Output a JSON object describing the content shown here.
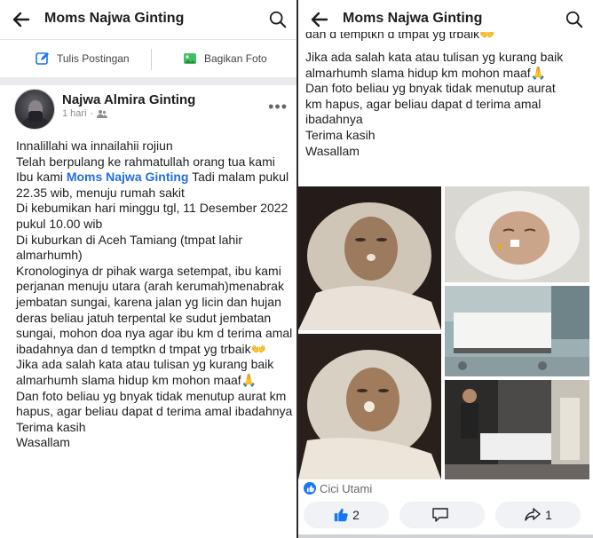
{
  "header": {
    "title": "Moms Najwa Ginting"
  },
  "composer": {
    "write_label": "Tulis Postingan",
    "photo_label": "Bagikan Foto"
  },
  "post": {
    "author": "Najwa Almira Ginting",
    "time": "1 hari",
    "separator": "·",
    "lines_left": {
      "l1": "Innalillahi wa innailahii rojiun",
      "l2": "Telah berpulang ke rahmatullah orang tua kami",
      "l3_pre": "Ibu kami ",
      "l3_mention": "Moms Najwa Ginting",
      "l3_post": " Tadi malam pukul 22.35 wib, menuju rumah sakit",
      "l4": "Di kebumikan hari minggu tgl, 11 Desember 2022 pukul 10.00 wib",
      "l5": "Di kuburkan di Aceh Tamiang (tmpat lahir almarhumh)",
      "l6": "Kronologinya dr pihak warga setempat, ibu kami perjanan menuju utara (arah kerumah)menabrak jembatan sungai, karena jalan yg licin dan hujan deras beliau jatuh terpental ke sudut jembatan sungai, mohon doa nya agar ibu km d terima amal ibadahnya dan d temptkn d tmpat yg trbaik👐",
      "l7": "Jika ada salah kata atau tulisan yg kurang baik almarhumh slama hidup km mohon maaf🙏",
      "l8": "Dan foto beliau yg bnyak tidak menutup aurat km hapus, agar beliau dapat d terima amal ibadahnya",
      "l9": "Terima kasih",
      "l10": "Wasallam"
    },
    "lines_right": {
      "clipped": "dan d temptkn d tmpat yg trbaik👐",
      "r1": "Jika ada salah kata atau tulisan yg kurang baik almarhumh slama hidup km mohon maaf🙏",
      "r2": "Dan foto beliau yg bnyak tidak menutup aurat km hapus, agar beliau dapat d terima amal ibadahnya",
      "r3": "Terima kasih",
      "r4": "Wasallam"
    },
    "reactions_name": "Cici Utami",
    "like_count": "2",
    "share_count": "1"
  },
  "icons": {
    "back": "arrow-left-icon",
    "search": "search-icon",
    "edit": "edit-square-icon",
    "photo": "photo-icon",
    "more": "more-horizontal-icon",
    "privacy": "friends-icon",
    "like": "thumbs-up-icon",
    "comment": "comment-bubble-icon",
    "share": "share-arrow-icon"
  },
  "colors": {
    "accent": "#1877f2",
    "mention": "#216fdb",
    "text": "#1c1e21",
    "muted": "#8a8d91",
    "pill_bg": "#f0f2f5"
  }
}
